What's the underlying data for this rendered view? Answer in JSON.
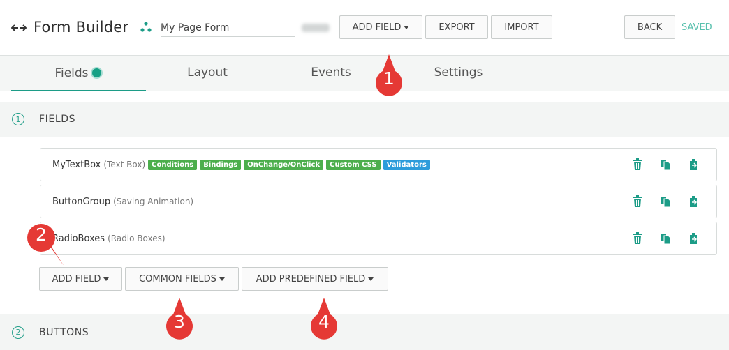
{
  "header": {
    "title": "Form Builder",
    "form_name": "My Page Form",
    "add_field_label": "ADD FIELD",
    "export_label": "EXPORT",
    "import_label": "IMPORT",
    "back_label": "BACK",
    "status": "SAVED"
  },
  "tabs": [
    {
      "label": "Fields",
      "active": true
    },
    {
      "label": "Layout"
    },
    {
      "label": "Events"
    },
    {
      "label": "Settings"
    }
  ],
  "sections": [
    {
      "number": "1",
      "title": "FIELDS"
    },
    {
      "number": "2",
      "title": "BUTTONS"
    }
  ],
  "fields": [
    {
      "name": "MyTextBox",
      "type": "(Text Box)",
      "badges": [
        {
          "label": "Conditions",
          "color": "#4cae4c"
        },
        {
          "label": "Bindings",
          "color": "#4cae4c"
        },
        {
          "label": "OnChange/OnClick",
          "color": "#4cae4c"
        },
        {
          "label": "Custom CSS",
          "color": "#4cae4c"
        },
        {
          "label": "Validators",
          "color": "#2d9cdb"
        }
      ]
    },
    {
      "name": "ButtonGroup",
      "type": "(Saving Animation)",
      "badges": []
    },
    {
      "name": "RadioBoxes",
      "type": "(Radio Boxes)",
      "badges": []
    }
  ],
  "field_buttons": {
    "add_field": "ADD FIELD",
    "common_fields": "COMMON FIELDS",
    "add_predefined": "ADD PREDEFINED FIELD"
  },
  "markers": [
    "1",
    "2",
    "3",
    "4"
  ],
  "icons": [
    "back-arrow-icon",
    "dots-icon",
    "trash-icon",
    "copy-icon",
    "clipboard-icon"
  ],
  "colors": {
    "accent": "#1c9c87",
    "badge_green": "#4cae4c",
    "badge_blue": "#2d9cdb",
    "marker_red": "#e53935",
    "saved": "#58c0ad"
  }
}
